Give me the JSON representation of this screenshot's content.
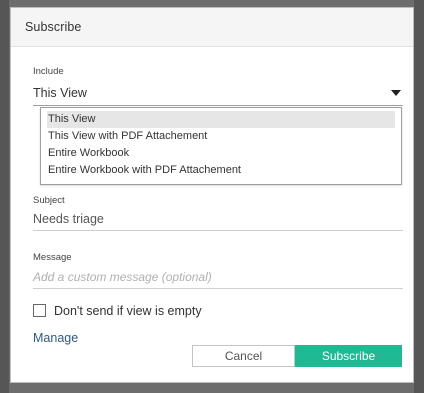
{
  "dialog": {
    "title": "Subscribe"
  },
  "include": {
    "label": "Include",
    "selected_value": "This View",
    "options": [
      "This View",
      "This View with PDF Attachement",
      "Entire Workbook",
      "Entire Workbook with PDF Attachement"
    ]
  },
  "subject": {
    "label": "Subject",
    "value": "Needs triage"
  },
  "message": {
    "label": "Message",
    "placeholder": "Add a custom message (optional)"
  },
  "empty_view_option": {
    "label": "Don't send if view is empty",
    "checked": false
  },
  "manage_link": "Manage",
  "buttons": {
    "cancel": "Cancel",
    "subscribe": "Subscribe"
  },
  "colors": {
    "primary_button": "#1fb993",
    "link": "#2e5b83",
    "overlay": "#6d6d6d"
  }
}
